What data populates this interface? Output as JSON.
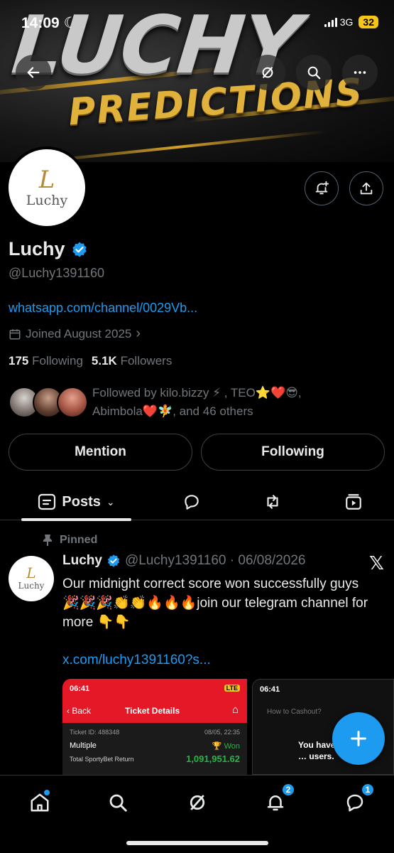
{
  "status_bar": {
    "time": "14:09",
    "network": "3G",
    "battery": "32"
  },
  "banner": {
    "title": "LUCHY",
    "subtitle": "PREDICTIONS"
  },
  "avatar": {
    "logo_letter": "L",
    "logo_text": "Luchy"
  },
  "profile": {
    "name": "Luchy",
    "handle": "@Luchy1391160",
    "link": "whatsapp.com/channel/0029Vb...",
    "joined": "Joined August 2025",
    "following_count": "175",
    "following_label": "Following",
    "followers_count": "5.1K",
    "followers_label": "Followers",
    "followed_by_line1": "Followed by kilo.bizzy ⚡ , TEO⭐❤️😎,",
    "followed_by_line2": "Abimbola❤️🧚, and 46 others"
  },
  "actions": {
    "mention": "Mention",
    "following": "Following"
  },
  "tabs": {
    "posts": "Posts"
  },
  "post": {
    "pinned_label": "Pinned",
    "author": "Luchy",
    "handle_date": "@Luchy1391160 · 06/08/2026",
    "text": "Our midnight correct score won successfully guys 🎉🎉🎉👏👏🔥🔥🔥join our telegram channel for more 👇👇",
    "link": "x.com/luchy1391160?s..."
  },
  "media1": {
    "time": "06:41",
    "network": "LTE",
    "back": "Back",
    "title": "Ticket Details",
    "ticket_id": "Ticket ID: 488348",
    "date": "08/05, 22:35",
    "bet_type": "Multiple",
    "status": "Won",
    "return_label": "Total SportyBet Return",
    "return_value": "1,091,951.62"
  },
  "media2": {
    "time": "06:41",
    "question": "How to Cashout?",
    "popup_text": "You have … than … users."
  },
  "nav": {
    "notifications_badge": "2",
    "messages_badge": "1"
  },
  "colors": {
    "accent": "#1d9bf0",
    "sporty_red": "#e41827",
    "won_green": "#2bb34a"
  }
}
